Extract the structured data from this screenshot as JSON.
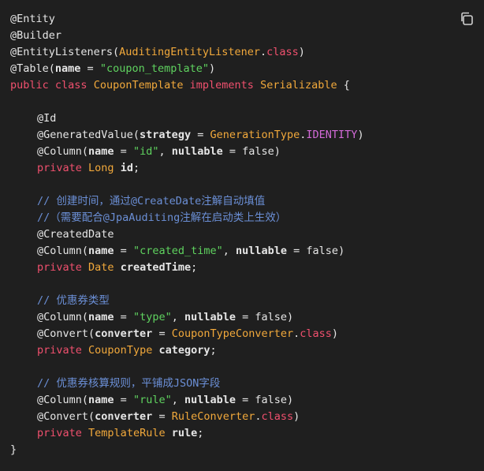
{
  "code_lines": [
    [
      {
        "t": "@Entity",
        "c": "ann"
      }
    ],
    [
      {
        "t": "@Builder",
        "c": "ann"
      }
    ],
    [
      {
        "t": "@EntityListeners(",
        "c": "ann"
      },
      {
        "t": "AuditingEntityListener",
        "c": "ty"
      },
      {
        "t": ".",
        "c": "plain"
      },
      {
        "t": "class",
        "c": "kw"
      },
      {
        "t": ")",
        "c": "plain"
      }
    ],
    [
      {
        "t": "@Table(",
        "c": "ann"
      },
      {
        "t": "name",
        "c": "ident"
      },
      {
        "t": " = ",
        "c": "plain"
      },
      {
        "t": "\"coupon_template\"",
        "c": "str"
      },
      {
        "t": ")",
        "c": "plain"
      }
    ],
    [
      {
        "t": "public",
        "c": "kw"
      },
      {
        "t": " ",
        "c": "plain"
      },
      {
        "t": "class",
        "c": "kw"
      },
      {
        "t": " ",
        "c": "plain"
      },
      {
        "t": "CouponTemplate",
        "c": "ty"
      },
      {
        "t": " ",
        "c": "plain"
      },
      {
        "t": "implements",
        "c": "kw"
      },
      {
        "t": " ",
        "c": "plain"
      },
      {
        "t": "Serializable",
        "c": "ty"
      },
      {
        "t": " {",
        "c": "plain"
      }
    ],
    [],
    [
      {
        "t": "@Id",
        "c": "ann",
        "i": 1
      }
    ],
    [
      {
        "t": "@GeneratedValue(",
        "c": "ann",
        "i": 1
      },
      {
        "t": "strategy",
        "c": "ident"
      },
      {
        "t": " = ",
        "c": "plain"
      },
      {
        "t": "GenerationType",
        "c": "ty"
      },
      {
        "t": ".",
        "c": "plain"
      },
      {
        "t": "IDENTITY",
        "c": "const"
      },
      {
        "t": ")",
        "c": "plain"
      }
    ],
    [
      {
        "t": "@Column(",
        "c": "ann",
        "i": 1
      },
      {
        "t": "name",
        "c": "ident"
      },
      {
        "t": " = ",
        "c": "plain"
      },
      {
        "t": "\"id\"",
        "c": "str"
      },
      {
        "t": ", ",
        "c": "plain"
      },
      {
        "t": "nullable",
        "c": "ident"
      },
      {
        "t": " = ",
        "c": "plain"
      },
      {
        "t": "false",
        "c": "plain"
      },
      {
        "t": ")",
        "c": "plain"
      }
    ],
    [
      {
        "t": "private",
        "c": "kw",
        "i": 1
      },
      {
        "t": " ",
        "c": "plain"
      },
      {
        "t": "Long",
        "c": "ty"
      },
      {
        "t": " ",
        "c": "plain"
      },
      {
        "t": "id",
        "c": "ident"
      },
      {
        "t": ";",
        "c": "plain"
      }
    ],
    [],
    [
      {
        "t": "// 创建时间，通过@CreateDate注解自动填值",
        "c": "cm",
        "i": 1
      }
    ],
    [
      {
        "t": "//（需要配合@JpaAuditing注解在启动类上生效）",
        "c": "cm",
        "i": 1
      }
    ],
    [
      {
        "t": "@CreatedDate",
        "c": "ann",
        "i": 1
      }
    ],
    [
      {
        "t": "@Column(",
        "c": "ann",
        "i": 1
      },
      {
        "t": "name",
        "c": "ident"
      },
      {
        "t": " = ",
        "c": "plain"
      },
      {
        "t": "\"created_time\"",
        "c": "str"
      },
      {
        "t": ", ",
        "c": "plain"
      },
      {
        "t": "nullable",
        "c": "ident"
      },
      {
        "t": " = ",
        "c": "plain"
      },
      {
        "t": "false",
        "c": "plain"
      },
      {
        "t": ")",
        "c": "plain"
      }
    ],
    [
      {
        "t": "private",
        "c": "kw",
        "i": 1
      },
      {
        "t": " ",
        "c": "plain"
      },
      {
        "t": "Date",
        "c": "ty"
      },
      {
        "t": " ",
        "c": "plain"
      },
      {
        "t": "createdTime",
        "c": "ident"
      },
      {
        "t": ";",
        "c": "plain"
      }
    ],
    [],
    [
      {
        "t": "// 优惠券类型",
        "c": "cm",
        "i": 1
      }
    ],
    [
      {
        "t": "@Column(",
        "c": "ann",
        "i": 1
      },
      {
        "t": "name",
        "c": "ident"
      },
      {
        "t": " = ",
        "c": "plain"
      },
      {
        "t": "\"type\"",
        "c": "str"
      },
      {
        "t": ", ",
        "c": "plain"
      },
      {
        "t": "nullable",
        "c": "ident"
      },
      {
        "t": " = ",
        "c": "plain"
      },
      {
        "t": "false",
        "c": "plain"
      },
      {
        "t": ")",
        "c": "plain"
      }
    ],
    [
      {
        "t": "@Convert(",
        "c": "ann",
        "i": 1
      },
      {
        "t": "converter",
        "c": "ident"
      },
      {
        "t": " = ",
        "c": "plain"
      },
      {
        "t": "CouponTypeConverter",
        "c": "ty"
      },
      {
        "t": ".",
        "c": "plain"
      },
      {
        "t": "class",
        "c": "kw"
      },
      {
        "t": ")",
        "c": "plain"
      }
    ],
    [
      {
        "t": "private",
        "c": "kw",
        "i": 1
      },
      {
        "t": " ",
        "c": "plain"
      },
      {
        "t": "CouponType",
        "c": "ty"
      },
      {
        "t": " ",
        "c": "plain"
      },
      {
        "t": "category",
        "c": "ident"
      },
      {
        "t": ";",
        "c": "plain"
      }
    ],
    [],
    [
      {
        "t": "// 优惠券核算规则，平铺成JSON字段",
        "c": "cm",
        "i": 1
      }
    ],
    [
      {
        "t": "@Column(",
        "c": "ann",
        "i": 1
      },
      {
        "t": "name",
        "c": "ident"
      },
      {
        "t": " = ",
        "c": "plain"
      },
      {
        "t": "\"rule\"",
        "c": "str"
      },
      {
        "t": ", ",
        "c": "plain"
      },
      {
        "t": "nullable",
        "c": "ident"
      },
      {
        "t": " = ",
        "c": "plain"
      },
      {
        "t": "false",
        "c": "plain"
      },
      {
        "t": ")",
        "c": "plain"
      }
    ],
    [
      {
        "t": "@Convert(",
        "c": "ann",
        "i": 1
      },
      {
        "t": "converter",
        "c": "ident"
      },
      {
        "t": " = ",
        "c": "plain"
      },
      {
        "t": "RuleConverter",
        "c": "ty"
      },
      {
        "t": ".",
        "c": "plain"
      },
      {
        "t": "class",
        "c": "kw"
      },
      {
        "t": ")",
        "c": "plain"
      }
    ],
    [
      {
        "t": "private",
        "c": "kw",
        "i": 1
      },
      {
        "t": " ",
        "c": "plain"
      },
      {
        "t": "TemplateRule",
        "c": "ty"
      },
      {
        "t": " ",
        "c": "plain"
      },
      {
        "t": "rule",
        "c": "ident"
      },
      {
        "t": ";",
        "c": "plain"
      }
    ],
    [
      {
        "t": "}",
        "c": "plain"
      }
    ]
  ],
  "colors": {
    "background": "#1f1f1f",
    "keyword": "#f0506e",
    "type": "#f2a93b",
    "string": "#5fd35f",
    "comment": "#6b8fd6",
    "constant": "#d36ad8",
    "text": "#e6e6e6"
  },
  "copy_button": {
    "icon": "copy-icon"
  }
}
